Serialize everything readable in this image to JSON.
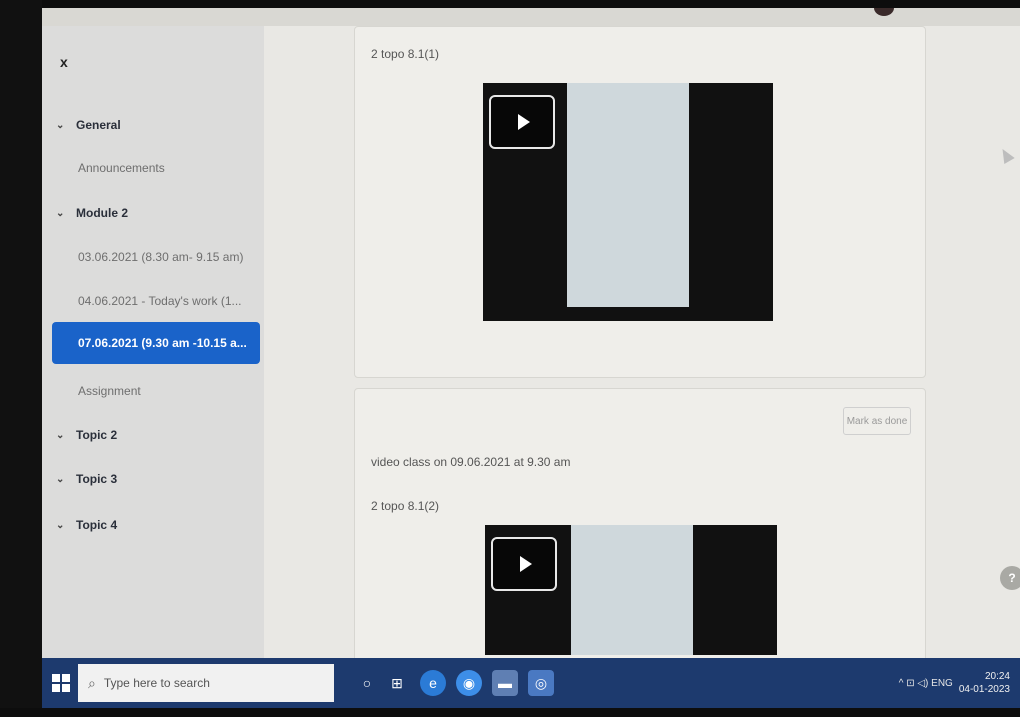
{
  "sidebar": {
    "close_label": "x",
    "items": [
      {
        "label": "General",
        "type": "section"
      },
      {
        "label": "Announcements",
        "type": "sub"
      },
      {
        "label": "Module 2",
        "type": "section"
      },
      {
        "label": "03.06.2021 (8.30 am- 9.15 am)",
        "type": "sub"
      },
      {
        "label": "04.06.2021 - Today's work (1...",
        "type": "sub"
      },
      {
        "label": "07.06.2021 (9.30 am -10.15 a...",
        "type": "active"
      },
      {
        "label": "Assignment",
        "type": "sub"
      },
      {
        "label": "Topic 2",
        "type": "section"
      },
      {
        "label": "Topic 3",
        "type": "section"
      },
      {
        "label": "Topic 4",
        "type": "section"
      }
    ]
  },
  "main": {
    "card1": {
      "title": "2 topo 8.1(1)"
    },
    "card2": {
      "mark_done": "Mark as done",
      "description": "video class on 09.06.2021 at 9.30 am",
      "title": "2 topo 8.1(2)"
    },
    "help_label": "?"
  },
  "taskbar": {
    "search_placeholder": "Type here to search",
    "tray_text": "^ ⊡ ◁) ENG",
    "time": "20:24",
    "date": "04-01-2023"
  },
  "colors": {
    "accent": "#1a63c9",
    "taskbar": "#1d3a6e"
  }
}
